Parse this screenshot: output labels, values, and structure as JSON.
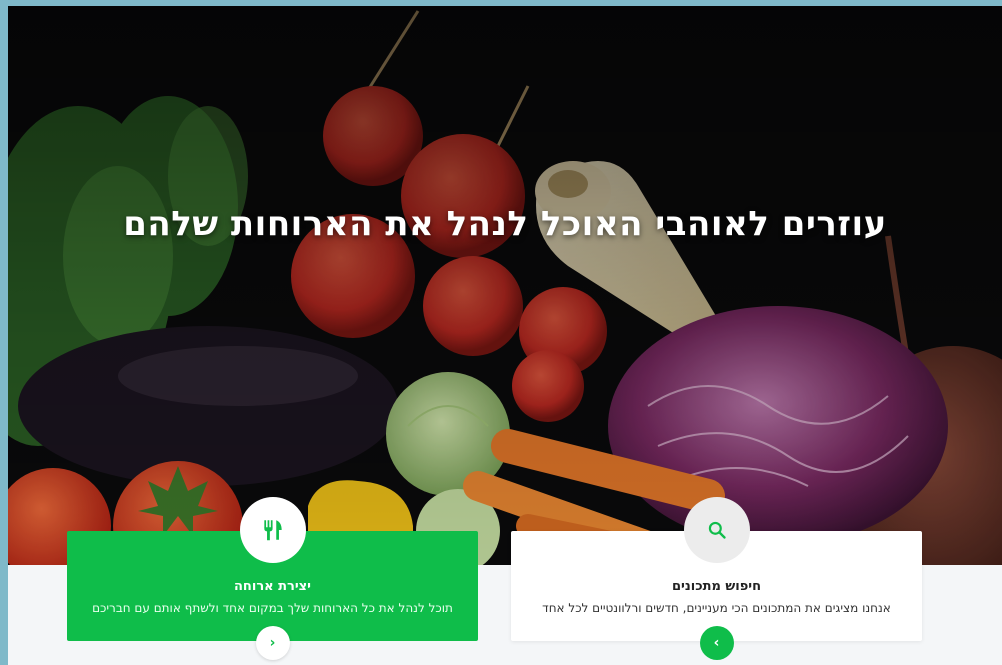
{
  "hero": {
    "title": "עוזרים לאוהבי האוכל לנהל את הארוחות שלהם",
    "image": "vegetables-background"
  },
  "features": [
    {
      "title": "יצירת ארוחה",
      "text": "תוכל לנהל את כל הארוחות שלך במקום אחד ולשתף אותם עם חבריכם",
      "icon": "fork-knife-icon",
      "more": "‹"
    },
    {
      "title": "חיפוש מתכונים",
      "text": "אנחנו מציגים את המתכונים הכי מעניינים, חדשים ורלוונטיים לכל אחד",
      "icon": "search-icon",
      "more": "›"
    }
  ],
  "colors": {
    "accent": "#0fbd4a",
    "frame": "#7fb9c9",
    "page_bg": "#f4f6f8",
    "card_white": "#ffffff"
  }
}
